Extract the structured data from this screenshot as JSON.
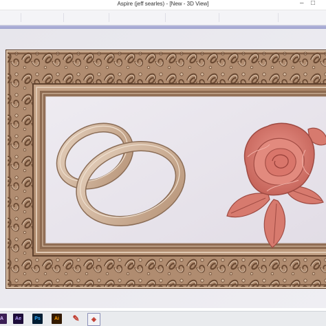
{
  "window": {
    "title": "Aspire (jeff searles) - [New - 3D View]"
  },
  "taskbar": {
    "apps": [
      {
        "name": "adobe-app",
        "label": "A",
        "glyph": "A"
      },
      {
        "name": "after-effects",
        "label": "Ae",
        "glyph": "Ae"
      },
      {
        "name": "photoshop",
        "label": "Ps",
        "glyph": "Ps"
      },
      {
        "name": "illustrator",
        "label": "Ai",
        "glyph": "Ai"
      },
      {
        "name": "pen-tool",
        "label": "",
        "glyph": "✎"
      },
      {
        "name": "aspire",
        "label": "",
        "glyph": "◈"
      }
    ]
  },
  "view": {
    "mode": "3D View",
    "models": [
      "ornate-frame",
      "wedding-rings",
      "rose"
    ],
    "colors": {
      "background": "#ecebf0",
      "wood": "#b08c70",
      "wood_dark": "#6b4a33",
      "wood_light": "#d7bea6",
      "panel": "#e9e6ee",
      "rose": "#db7e72",
      "rose_dark": "#a8463f",
      "rings": "#cfb49c"
    }
  }
}
